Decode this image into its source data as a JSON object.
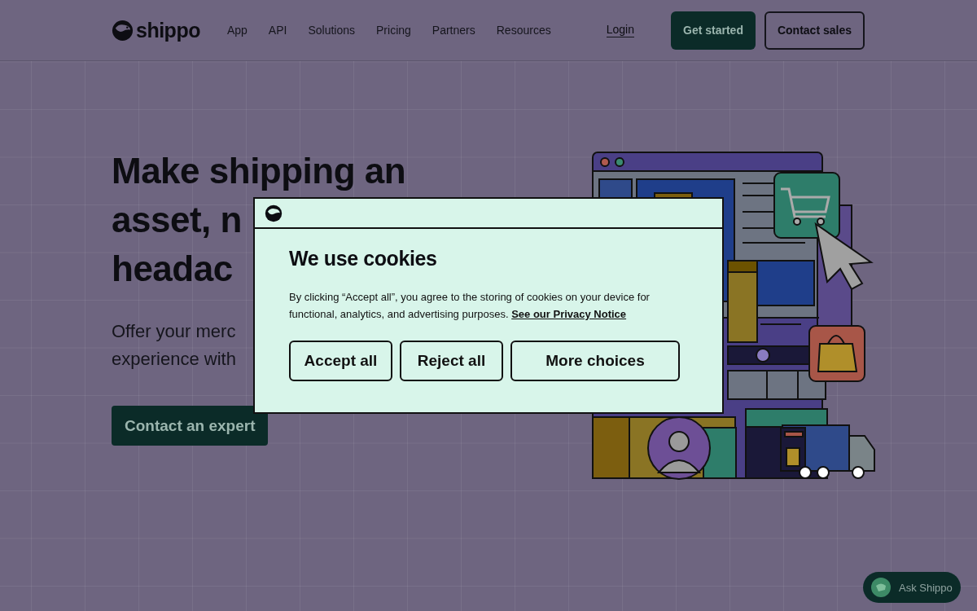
{
  "nav": {
    "logo": "shippo",
    "links": [
      "App",
      "API",
      "Solutions",
      "Pricing",
      "Partners",
      "Resources"
    ],
    "login": "Login",
    "primary_button": "Get started",
    "secondary_button": "Contact sales"
  },
  "hero": {
    "headline_lines": [
      "Make shipping an",
      "asset, n",
      "headac"
    ],
    "subtitle_lines": [
      "Offer your merc",
      "experience with"
    ],
    "button": "Contact an expert"
  },
  "cookie_dialog": {
    "title": "We use cookies",
    "body": "By clicking “Accept all”, you agree to the storing of cookies on your device for functional, analytics, and advertising purposes.",
    "link": "See our Privacy Notice",
    "buttons": [
      "Accept all",
      "Reject all",
      "More choices"
    ]
  },
  "chat_button": {
    "label": "Ask Shippo"
  }
}
